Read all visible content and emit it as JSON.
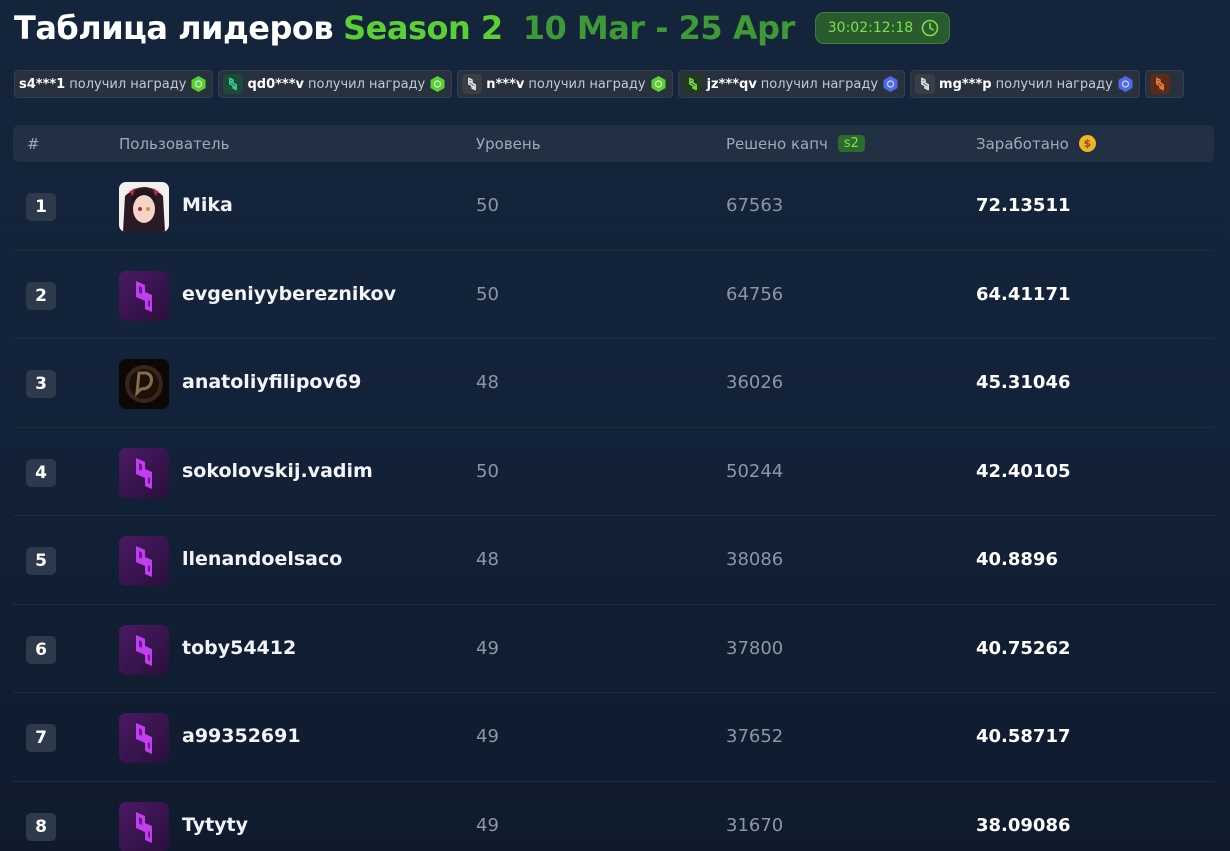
{
  "header": {
    "title": "Таблица лидеров",
    "season": "Season 2",
    "dates": "10 Mar - 25 Apr",
    "timer": "30:02:12:18"
  },
  "ticker": [
    {
      "user": "s4***1",
      "text": "получил награду",
      "badge_color": "#5ad034",
      "avatar_color": "#2a3442",
      "icon": "none"
    },
    {
      "user": "qd0***v",
      "text": "получил награду",
      "badge_color": "#5ad034",
      "avatar_color": "#1d4a3a",
      "icon": "logo-green"
    },
    {
      "user": "n***v",
      "text": "получил награду",
      "badge_color": "#5ad034",
      "avatar_color": "#3a3f47",
      "icon": "logo-white"
    },
    {
      "user": "jz***qv",
      "text": "получил награду",
      "badge_color": "#4d6be8",
      "avatar_color": "#243a1f",
      "icon": "logo-lime"
    },
    {
      "user": "mg***p",
      "text": "получил награду",
      "badge_color": "#4d6be8",
      "avatar_color": "#3a3f47",
      "icon": "logo-white"
    },
    {
      "user": "",
      "text": "",
      "badge_color": "#4d6be8",
      "avatar_color": "#5a2a1a",
      "icon": "logo-orange"
    }
  ],
  "table": {
    "headers": {
      "rank": "#",
      "user": "Пользователь",
      "level": "Уровень",
      "solved": "Решено капч",
      "solved_badge": "s2",
      "earned": "Заработано",
      "earned_icon": "$"
    },
    "rows": [
      {
        "rank": "1",
        "name": "Mika",
        "level": "50",
        "solved": "67563",
        "earned": "72.13511",
        "avatar": "anime-photo"
      },
      {
        "rank": "2",
        "name": "evgeniyybereznikov",
        "level": "50",
        "solved": "64756",
        "earned": "64.41171",
        "avatar": "default-logo"
      },
      {
        "rank": "3",
        "name": "anatoliyfilipov69",
        "level": "48",
        "solved": "36026",
        "earned": "45.31046",
        "avatar": "dark-photo"
      },
      {
        "rank": "4",
        "name": "sokolovskij.vadim",
        "level": "50",
        "solved": "50244",
        "earned": "42.40105",
        "avatar": "default-logo"
      },
      {
        "rank": "5",
        "name": "llenandoelsaco",
        "level": "48",
        "solved": "38086",
        "earned": "40.8896",
        "avatar": "default-logo"
      },
      {
        "rank": "6",
        "name": "toby54412",
        "level": "49",
        "solved": "37800",
        "earned": "40.75262",
        "avatar": "default-logo"
      },
      {
        "rank": "7",
        "name": "a99352691",
        "level": "49",
        "solved": "37652",
        "earned": "40.58717",
        "avatar": "default-logo"
      },
      {
        "rank": "8",
        "name": "Tytyty",
        "level": "49",
        "solved": "31670",
        "earned": "38.09086",
        "avatar": "default-logo"
      }
    ]
  },
  "colors": {
    "accent_green": "#5ad034",
    "logo_purple": "#c13ef0"
  }
}
